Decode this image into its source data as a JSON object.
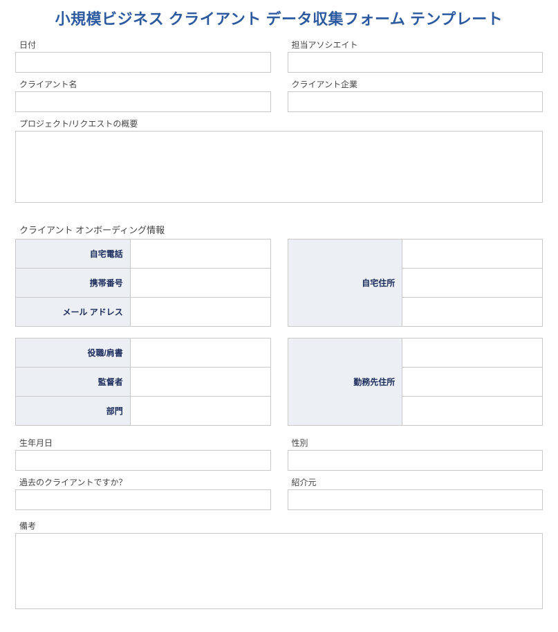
{
  "title": "小規模ビジネス クライアント データ収集フォーム テンプレート",
  "fields": {
    "date": "日付",
    "associate": "担当アソシエイト",
    "client_name": "クライアント名",
    "client_company": "クライアント企業",
    "project_summary": "プロジェクト/リクエストの概要",
    "onboarding_header": "クライアント オンボーディング情報",
    "home_phone": "自宅電話",
    "mobile": "携帯番号",
    "email": "メール アドレス",
    "home_address": "自宅住所",
    "title_position": "役職/肩書",
    "supervisor": "監督者",
    "department": "部門",
    "work_address": "勤務先住所",
    "dob": "生年月日",
    "gender": "性別",
    "past_client": "過去のクライアントですか？",
    "referral": "紹介元",
    "notes": "備考"
  }
}
